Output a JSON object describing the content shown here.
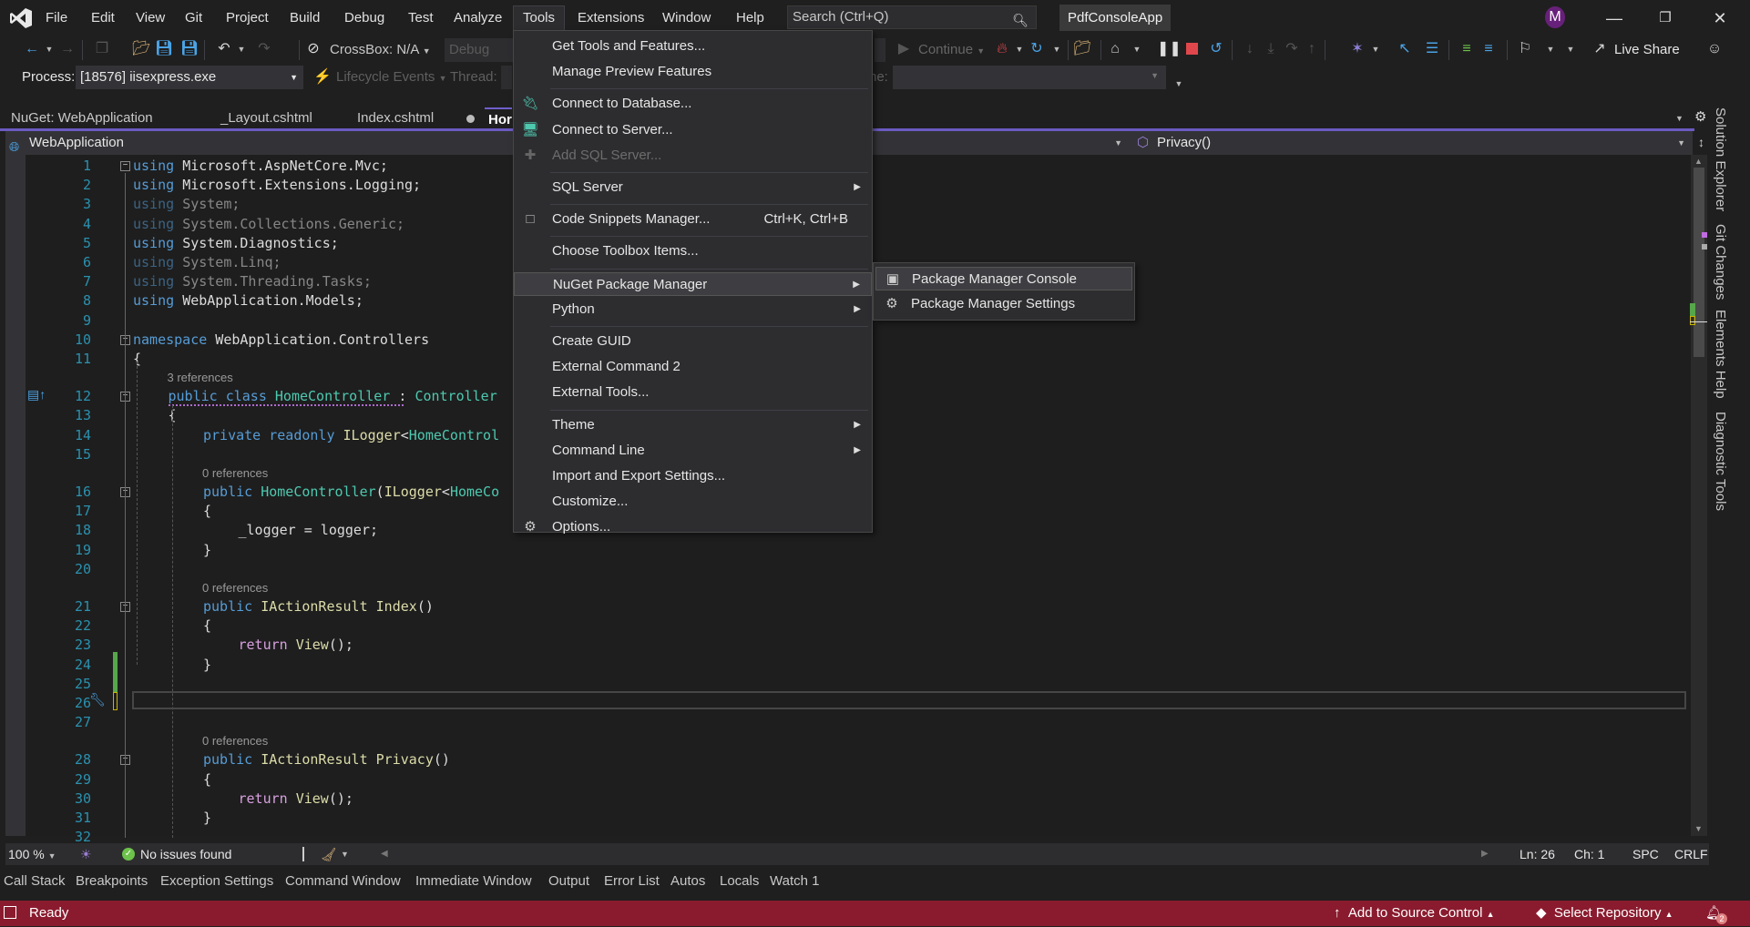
{
  "menubar": {
    "items": [
      "File",
      "Edit",
      "View",
      "Git",
      "Project",
      "Build",
      "Debug",
      "Test",
      "Analyze",
      "Tools",
      "Extensions",
      "Window",
      "Help"
    ],
    "open_menu": "Tools"
  },
  "search": {
    "placeholder": "Search (Ctrl+Q)"
  },
  "solution_name": "PdfConsoleApp",
  "avatar_initial": "M",
  "toolbar": {
    "crossbox_label": "CrossBox: N/A",
    "config_label": "Debug",
    "continue_label": "Continue",
    "live_share_label": "Live Share",
    "process_label": "Process:",
    "process_value": "[18576] iisexpress.exe",
    "lifecycle_label": "Lifecycle Events",
    "thread_label": "Thread:",
    "frame_label_fragment": "ne:"
  },
  "document_tabs": [
    {
      "label": "NuGet: WebApplication",
      "active": false
    },
    {
      "label": "_Layout.cshtml",
      "active": false
    },
    {
      "label": "Index.cshtml",
      "active": false,
      "modified": true
    },
    {
      "label": "Hor",
      "active": true
    }
  ],
  "navbar": {
    "project": "WebApplication",
    "member": "Privacy()"
  },
  "code": {
    "lines": [
      {
        "n": "1",
        "tokens": [
          [
            "kw",
            "using"
          ],
          [
            "",
            "  "
          ],
          [
            "",
            "Microsoft.AspNetCore.Mvc;"
          ]
        ]
      },
      {
        "n": "2",
        "tokens": [
          [
            "kw",
            "using"
          ],
          [
            "",
            "  "
          ],
          [
            "",
            "Microsoft.Extensions.Logging;"
          ]
        ]
      },
      {
        "n": "3",
        "dim": true,
        "tokens": [
          [
            "kw",
            "using"
          ],
          [
            "",
            "  "
          ],
          [
            "",
            "System;"
          ]
        ]
      },
      {
        "n": "4",
        "dim": true,
        "tokens": [
          [
            "kw",
            "using"
          ],
          [
            "",
            "  "
          ],
          [
            "",
            "System.Collections.Generic;"
          ]
        ]
      },
      {
        "n": "5",
        "tokens": [
          [
            "kw",
            "using"
          ],
          [
            "",
            "  "
          ],
          [
            "",
            "System.Diagnostics;"
          ]
        ]
      },
      {
        "n": "6",
        "dim": true,
        "tokens": [
          [
            "kw",
            "using"
          ],
          [
            "",
            "  "
          ],
          [
            "",
            "System.Linq;"
          ]
        ]
      },
      {
        "n": "7",
        "dim": true,
        "tokens": [
          [
            "kw",
            "using"
          ],
          [
            "",
            "  "
          ],
          [
            "",
            "System.Threading.Tasks;"
          ]
        ]
      },
      {
        "n": "8",
        "tokens": [
          [
            "kw",
            "using"
          ],
          [
            "",
            "  "
          ],
          [
            "",
            "WebApplication.Models;"
          ]
        ]
      },
      {
        "n": "9",
        "tokens": []
      },
      {
        "n": "10",
        "tokens": [
          [
            "kw",
            "namespace"
          ],
          [
            "",
            " WebApplication.Controllers"
          ]
        ]
      },
      {
        "n": "11",
        "tokens": [
          [
            "",
            "{"
          ]
        ]
      },
      {
        "n": "12",
        "lens": "3 references",
        "indent": 1,
        "tokens": [
          [
            "kw",
            "public"
          ],
          [
            "",
            " "
          ],
          [
            "kw",
            "class"
          ],
          [
            "",
            " "
          ],
          [
            "ty",
            "HomeController"
          ],
          [
            "",
            " : "
          ],
          [
            "ty",
            "Controller"
          ]
        ]
      },
      {
        "n": "13",
        "indent": 1,
        "tokens": [
          [
            "",
            "{"
          ]
        ]
      },
      {
        "n": "14",
        "indent": 2,
        "tokens": [
          [
            "kw",
            "private"
          ],
          [
            "",
            " "
          ],
          [
            "kw",
            "readonly"
          ],
          [
            "",
            " "
          ],
          [
            "fn",
            "ILogger"
          ],
          [
            "",
            "<"
          ],
          [
            "ty",
            "HomeControl"
          ]
        ]
      },
      {
        "n": "15",
        "tokens": []
      },
      {
        "n": "16",
        "lens": "0 references",
        "indent": 2,
        "tokens": [
          [
            "kw",
            "public"
          ],
          [
            "",
            " "
          ],
          [
            "ty",
            "HomeController"
          ],
          [
            "",
            "("
          ],
          [
            "fn",
            "ILogger"
          ],
          [
            "",
            "<"
          ],
          [
            "ty",
            "HomeCo"
          ]
        ]
      },
      {
        "n": "17",
        "indent": 2,
        "tokens": [
          [
            "",
            "{"
          ]
        ]
      },
      {
        "n": "18",
        "indent": 3,
        "tokens": [
          [
            "",
            "_logger = logger;"
          ]
        ]
      },
      {
        "n": "19",
        "indent": 2,
        "tokens": [
          [
            "",
            "}"
          ]
        ]
      },
      {
        "n": "20",
        "tokens": []
      },
      {
        "n": "21",
        "lens": "0 references",
        "indent": 2,
        "tokens": [
          [
            "kw",
            "public"
          ],
          [
            "",
            " "
          ],
          [
            "fn",
            "IActionResult"
          ],
          [
            "",
            " "
          ],
          [
            "fn",
            "Index"
          ],
          [
            "",
            "()"
          ]
        ]
      },
      {
        "n": "22",
        "indent": 2,
        "tokens": [
          [
            "",
            "{"
          ]
        ]
      },
      {
        "n": "23",
        "indent": 3,
        "tokens": [
          [
            "ctl",
            "return"
          ],
          [
            "",
            " "
          ],
          [
            "fn",
            "View"
          ],
          [
            "",
            "();"
          ]
        ]
      },
      {
        "n": "24",
        "indent": 2,
        "tokens": [
          [
            "",
            "}"
          ]
        ]
      },
      {
        "n": "25",
        "tokens": []
      },
      {
        "n": "26",
        "tokens": []
      },
      {
        "n": "27",
        "tokens": []
      },
      {
        "n": "28",
        "lens": "0 references",
        "indent": 2,
        "tokens": [
          [
            "kw",
            "public"
          ],
          [
            "",
            " "
          ],
          [
            "fn",
            "IActionResult"
          ],
          [
            "",
            " "
          ],
          [
            "fn",
            "Privacy"
          ],
          [
            "",
            "()"
          ]
        ]
      },
      {
        "n": "29",
        "indent": 2,
        "tokens": [
          [
            "",
            "{"
          ]
        ]
      },
      {
        "n": "30",
        "indent": 3,
        "tokens": [
          [
            "ctl",
            "return"
          ],
          [
            "",
            " "
          ],
          [
            "fn",
            "View"
          ],
          [
            "",
            "();"
          ]
        ]
      },
      {
        "n": "31",
        "indent": 2,
        "tokens": [
          [
            "",
            "}"
          ]
        ]
      },
      {
        "n": "32",
        "tokens": []
      }
    ]
  },
  "tools_menu": {
    "items": [
      {
        "label": "Get Tools and Features..."
      },
      {
        "label": "Manage Preview Features"
      },
      {
        "sep": true
      },
      {
        "label": "Connect to Database...",
        "icon": "database-plug"
      },
      {
        "label": "Connect to Server...",
        "icon": "server-plug"
      },
      {
        "label": "Add SQL Server...",
        "icon": "add-server",
        "disabled": true
      },
      {
        "sep": true
      },
      {
        "label": "SQL Server",
        "submenu": true
      },
      {
        "sep": true
      },
      {
        "label": "Code Snippets Manager...",
        "shortcut": "Ctrl+K, Ctrl+B",
        "icon": "snippet"
      },
      {
        "sep": true
      },
      {
        "label": "Choose Toolbox Items..."
      },
      {
        "sep": true
      },
      {
        "label": "NuGet Package Manager",
        "submenu": true,
        "highlighted": true
      },
      {
        "label": "Python",
        "submenu": true
      },
      {
        "sep": true
      },
      {
        "label": "Create GUID"
      },
      {
        "label": "External Command 2"
      },
      {
        "label": "External Tools..."
      },
      {
        "sep": true
      },
      {
        "label": "Theme",
        "submenu": true
      },
      {
        "label": "Command Line",
        "submenu": true
      },
      {
        "label": "Import and Export Settings..."
      },
      {
        "label": "Customize..."
      },
      {
        "label": "Options...",
        "icon": "gear"
      }
    ]
  },
  "nuget_submenu": {
    "items": [
      {
        "label": "Package Manager Console",
        "icon": "console",
        "highlighted": true
      },
      {
        "label": "Package Manager Settings",
        "icon": "gear"
      }
    ]
  },
  "side_tabs": [
    "Solution Explorer",
    "Git Changes",
    "Elements Help",
    "Diagnostic Tools"
  ],
  "editor_status": {
    "zoom": "100 %",
    "issues": "No issues found",
    "line": "Ln: 26",
    "col": "Ch: 1",
    "whitespace": "SPC",
    "line_ending": "CRLF"
  },
  "tool_tabs": [
    "Call Stack",
    "Breakpoints",
    "Exception Settings",
    "Command Window",
    "Immediate Window",
    "Output",
    "Error List",
    "Autos",
    "Locals",
    "Watch 1"
  ],
  "statusbar": {
    "ready": "Ready",
    "source_control": "Add to Source Control",
    "repository": "Select Repository",
    "notifications_count": "2"
  },
  "colors": {
    "status_bar": "#8a1b2e",
    "accent": "#6b5bc2",
    "avatar": "#68217a"
  }
}
